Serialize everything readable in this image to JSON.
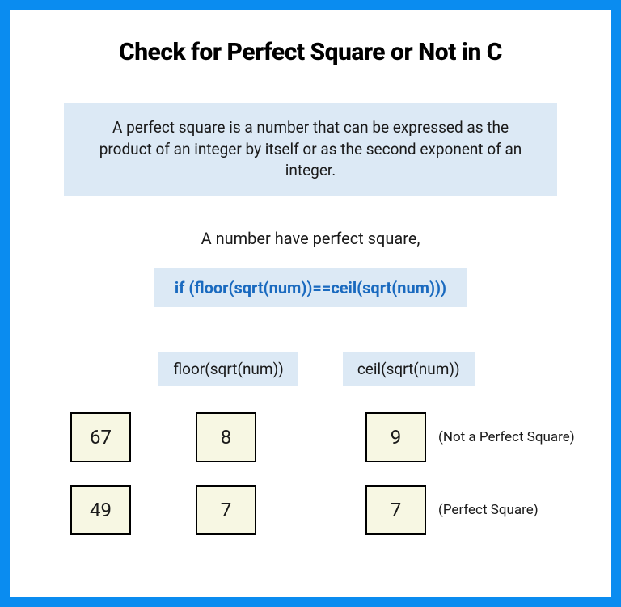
{
  "title": "Check for Perfect Square or Not in C",
  "definition": "A perfect square is a number that can be expressed as the product of an integer by itself or as the second exponent of an integer.",
  "subtitle": "A number have perfect square,",
  "condition_code": "if (floor(sqrt(num))==ceil(sqrt(num)))",
  "headers": {
    "floor": "floor(sqrt(num))",
    "ceil": "ceil(sqrt(num))"
  },
  "rows": [
    {
      "num": "67",
      "floor": "8",
      "ceil": "9",
      "result": "(Not a Perfect Square)"
    },
    {
      "num": "49",
      "floor": "7",
      "ceil": "7",
      "result": "(Perfect Square)"
    }
  ]
}
